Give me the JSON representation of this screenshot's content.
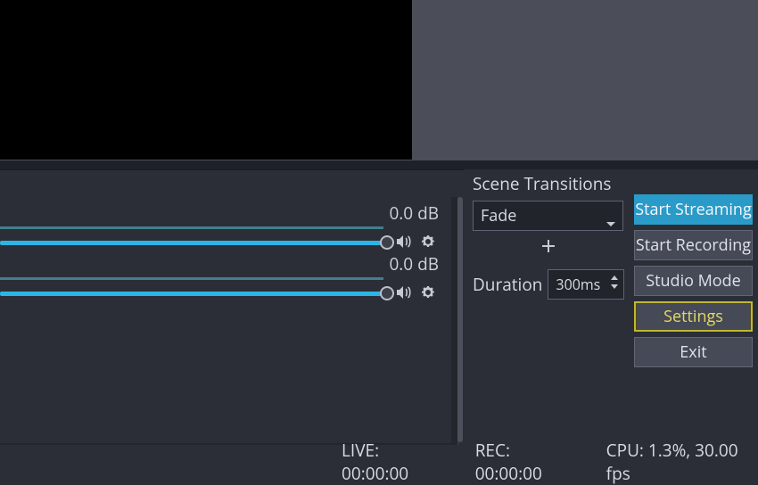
{
  "preview": {},
  "mixer": {
    "channels": [
      {
        "db": "0.0 dB"
      },
      {
        "db": "0.0 dB"
      }
    ]
  },
  "transitions": {
    "title": "Scene Transitions",
    "selected": "Fade",
    "duration_label": "Duration",
    "duration_value": "300ms"
  },
  "controls": {
    "start_streaming": "Start Streaming",
    "start_recording": "Start Recording",
    "studio_mode": "Studio Mode",
    "settings": "Settings",
    "exit": "Exit"
  },
  "status": {
    "live": "LIVE: 00:00:00",
    "rec": "REC: 00:00:00",
    "cpu": "CPU: 1.3%, 30.00 fps"
  }
}
